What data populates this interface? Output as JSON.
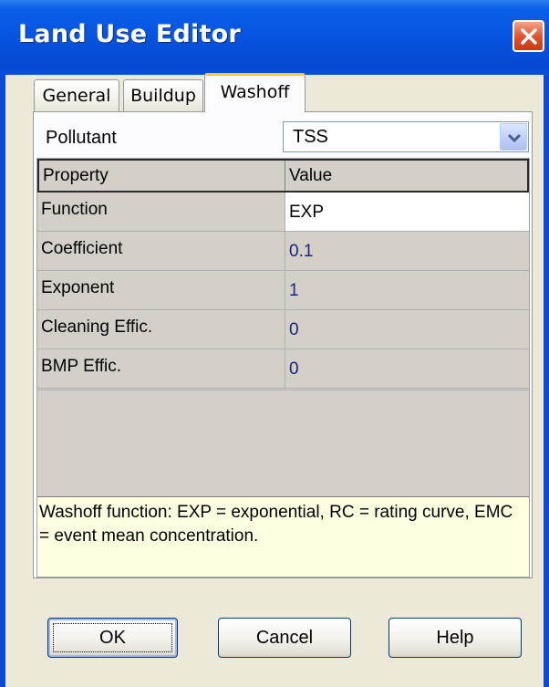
{
  "window": {
    "title": "Land Use Editor",
    "close_icon": "close-icon"
  },
  "tabs": [
    {
      "label": "General",
      "active": false
    },
    {
      "label": "Buildup",
      "active": false
    },
    {
      "label": "Washoff",
      "active": true
    }
  ],
  "pollutant": {
    "label": "Pollutant",
    "value": "TSS"
  },
  "grid": {
    "headers": [
      "Property",
      "Value"
    ],
    "rows": [
      {
        "property": "Function",
        "value": "EXP"
      },
      {
        "property": "Coefficient",
        "value": "0.1"
      },
      {
        "property": "Exponent",
        "value": "1"
      },
      {
        "property": "Cleaning Effic.",
        "value": "0"
      },
      {
        "property": "BMP Effic.",
        "value": "0"
      }
    ]
  },
  "hint": {
    "text": "Washoff function: EXP = exponential, RC = rating curve, EMC = event mean concentration."
  },
  "buttons": {
    "ok": "OK",
    "cancel": "Cancel",
    "help": "Help"
  },
  "colors": {
    "titlebar": "#0754df",
    "hint_background": "#ffffe1",
    "active_tab_accent": "#ffc83c"
  }
}
